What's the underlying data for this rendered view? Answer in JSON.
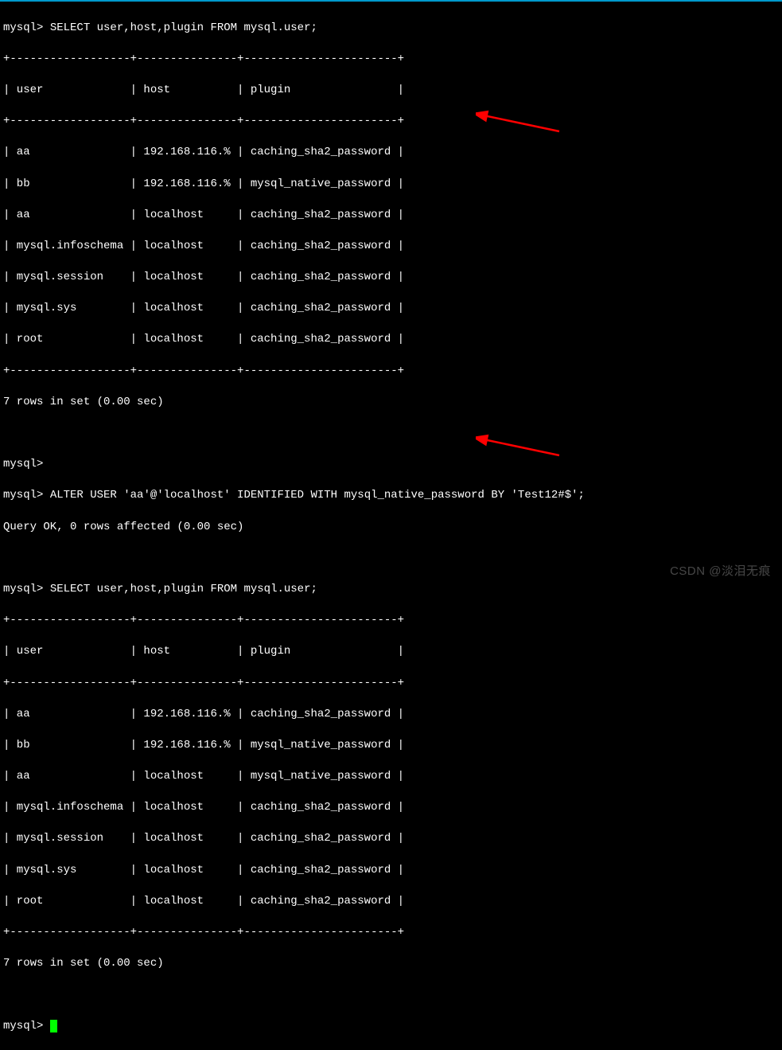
{
  "prompt": "mysql>",
  "blank_prompt": "mysql>",
  "query1": " SELECT user,host,plugin FROM mysql.user;",
  "query2": " ALTER USER 'aa'@'localhost' IDENTIFIED WITH mysql_native_password BY 'Test12#$';",
  "query2_result": "Query OK, 0 rows affected (0.00 sec)",
  "query3": " SELECT user,host,plugin FROM mysql.user;",
  "separator": "+------------------+---------------+-----------------------+",
  "header_row": "| user             | host          | plugin                |",
  "table1": {
    "rows": [
      "| aa               | 192.168.116.% | caching_sha2_password |",
      "| bb               | 192.168.116.% | mysql_native_password |",
      "| aa               | localhost     | caching_sha2_password |",
      "| mysql.infoschema | localhost     | caching_sha2_password |",
      "| mysql.session    | localhost     | caching_sha2_password |",
      "| mysql.sys        | localhost     | caching_sha2_password |",
      "| root             | localhost     | caching_sha2_password |"
    ],
    "footer": "7 rows in set (0.00 sec)"
  },
  "table2": {
    "rows": [
      "| aa               | 192.168.116.% | caching_sha2_password |",
      "| bb               | 192.168.116.% | mysql_native_password |",
      "| aa               | localhost     | mysql_native_password |",
      "| mysql.infoschema | localhost     | caching_sha2_password |",
      "| mysql.session    | localhost     | caching_sha2_password |",
      "| mysql.sys        | localhost     | caching_sha2_password |",
      "| root             | localhost     | caching_sha2_password |"
    ],
    "footer": "7 rows in set (0.00 sec)"
  },
  "watermark": "CSDN @淡泪无痕"
}
